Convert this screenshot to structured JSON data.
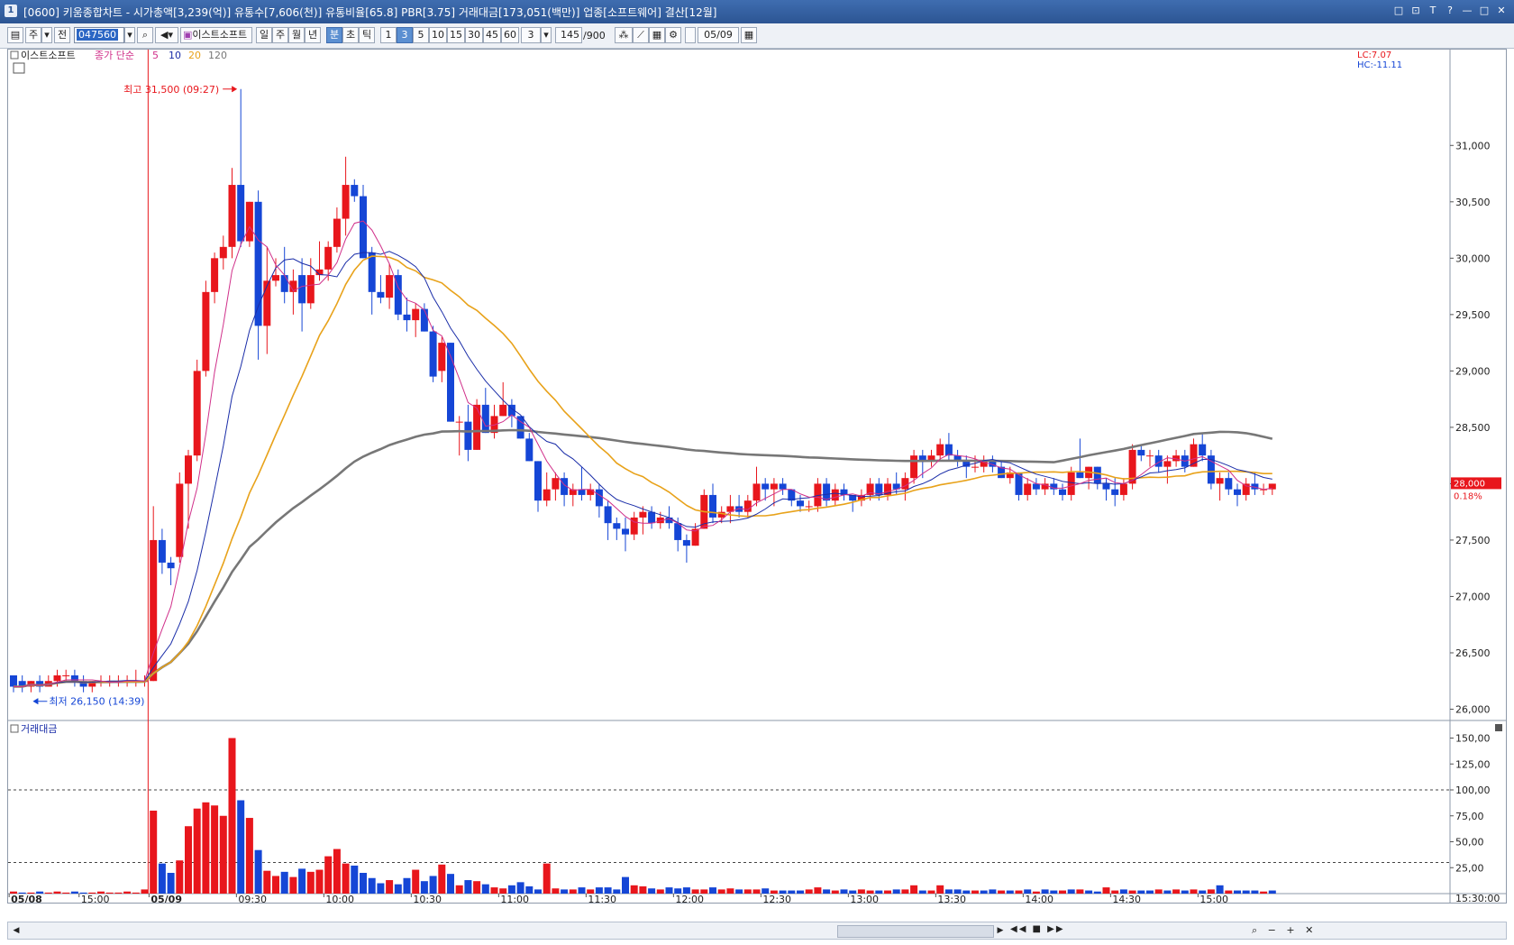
{
  "window": {
    "title": "[0600] 키움종합차트 - 시가총액[3,239(억)] 유통수[7,606(천)] 유통비율[65.8] PBR[3.75] 거래대금[173,051(백만)] 업종[소프트웨어] 결산[12월]",
    "icon_label": "1",
    "controls": [
      "□",
      "⊡",
      "T",
      "?",
      "—",
      "□",
      "✕"
    ]
  },
  "toolbar": {
    "period_label": "주",
    "prev_label": "전",
    "stock_code": "047560",
    "stock_name": "이스트소프트",
    "intervals": [
      "일",
      "주",
      "월",
      "년",
      "분",
      "초",
      "틱"
    ],
    "minute_options": [
      "1",
      "3",
      "5",
      "10",
      "15",
      "30",
      "45",
      "60"
    ],
    "selected_minute": "3",
    "custom_interval": "3",
    "count": "145",
    "count_max": "/900",
    "date": "05/09"
  },
  "chart": {
    "price_title": "이스트소프트",
    "ma_legend_prefix": "종가 단순",
    "ma_periods": [
      "5",
      "10",
      "20",
      "120"
    ],
    "ma_colors": [
      "#d0308a",
      "#1a2da8",
      "#e8a21a",
      "#777777"
    ],
    "high_annotation": "최고 31,500 (09:27)",
    "low_annotation": "최저 26,150 (14:39)",
    "lc_label": "LC:7.07",
    "hc_label": "HC:-11.11",
    "current_price": "28,000",
    "current_change": "0.18%",
    "volume_title": "거래대금",
    "bottom_end_time": "15:30:00"
  },
  "chart_data": [
    {
      "type": "candlestick",
      "title": "이스트소프트",
      "ylim": [
        25900,
        31850
      ],
      "y_ticks": [
        "26,000",
        "26,500",
        "27,000",
        "27,500",
        "28,000",
        "28,500",
        "29,000",
        "29,500",
        "30,000",
        "30,500",
        "31,000"
      ],
      "y_tick_values": [
        26000,
        26500,
        27000,
        27500,
        28000,
        28500,
        29000,
        29500,
        30000,
        30500,
        31000
      ],
      "x_labels": [
        "05/08",
        "15:00",
        "05/09",
        "09:30",
        "10:00",
        "10:30",
        "11:00",
        "11:30",
        "12:00",
        "12:30",
        "13:00",
        "13:30",
        "14:00",
        "14:30",
        "15:00"
      ],
      "x_label_candle_index": [
        0,
        8,
        16,
        26,
        36,
        46,
        56,
        66,
        76,
        86,
        96,
        106,
        116,
        126,
        136
      ],
      "candles": [
        [
          26300,
          26300,
          26150,
          26200
        ],
        [
          26250,
          26300,
          26150,
          26200
        ],
        [
          26200,
          26250,
          26150,
          26250
        ],
        [
          26250,
          26300,
          26150,
          26200
        ],
        [
          26200,
          26300,
          26200,
          26250
        ],
        [
          26250,
          26350,
          26200,
          26300
        ],
        [
          26300,
          26350,
          26250,
          26300
        ],
        [
          26300,
          26350,
          26200,
          26250
        ],
        [
          26250,
          26300,
          26150,
          26200
        ],
        [
          26200,
          26250,
          26150,
          26250
        ],
        [
          26250,
          26300,
          26200,
          26250
        ],
        [
          26250,
          26300,
          26200,
          26250
        ],
        [
          26250,
          26300,
          26200,
          26250
        ],
        [
          26250,
          26300,
          26200,
          26250
        ],
        [
          26250,
          26350,
          26200,
          26250
        ],
        [
          26250,
          26300,
          26200,
          26250
        ],
        [
          26250,
          27800,
          26250,
          27500
        ],
        [
          27500,
          27600,
          27200,
          27300
        ],
        [
          27300,
          27350,
          27100,
          27250
        ],
        [
          27350,
          28100,
          27300,
          28000
        ],
        [
          28000,
          28300,
          27600,
          28250
        ],
        [
          28250,
          29100,
          28200,
          29000
        ],
        [
          29000,
          29800,
          28950,
          29700
        ],
        [
          29700,
          30050,
          29600,
          30000
        ],
        [
          30000,
          30200,
          29900,
          30100
        ],
        [
          30100,
          30800,
          30000,
          30650
        ],
        [
          30650,
          31500,
          30100,
          30150
        ],
        [
          30150,
          30500,
          30100,
          30500
        ],
        [
          30500,
          30600,
          29100,
          29400
        ],
        [
          29400,
          30100,
          29150,
          29800
        ],
        [
          29800,
          30000,
          29750,
          29850
        ],
        [
          29850,
          30100,
          29600,
          29700
        ],
        [
          29700,
          29900,
          29500,
          29800
        ],
        [
          29850,
          30000,
          29350,
          29600
        ],
        [
          29600,
          30000,
          29550,
          29850
        ],
        [
          29850,
          30150,
          29800,
          29900
        ],
        [
          29900,
          30150,
          29800,
          30100
        ],
        [
          30100,
          30450,
          30050,
          30350
        ],
        [
          30350,
          30900,
          30200,
          30650
        ],
        [
          30650,
          30700,
          30500,
          30550
        ],
        [
          30550,
          30650,
          30000,
          30000
        ],
        [
          30050,
          30100,
          29500,
          29700
        ],
        [
          29700,
          29850,
          29600,
          29650
        ],
        [
          29650,
          29950,
          29550,
          29850
        ],
        [
          29850,
          29900,
          29450,
          29500
        ],
        [
          29500,
          29650,
          29350,
          29450
        ],
        [
          29450,
          29600,
          29300,
          29550
        ],
        [
          29550,
          29600,
          29350,
          29350
        ],
        [
          29350,
          29400,
          28900,
          28950
        ],
        [
          29000,
          29300,
          28900,
          29250
        ],
        [
          29250,
          29250,
          28550,
          28550
        ],
        [
          28550,
          28600,
          28250,
          28550
        ],
        [
          28550,
          28700,
          28200,
          28300
        ],
        [
          28300,
          28750,
          28300,
          28700
        ],
        [
          28700,
          28850,
          28450,
          28450
        ],
        [
          28450,
          28700,
          28400,
          28600
        ],
        [
          28600,
          28900,
          28600,
          28700
        ],
        [
          28700,
          28750,
          28500,
          28600
        ],
        [
          28600,
          28600,
          28400,
          28400
        ],
        [
          28400,
          28450,
          28200,
          28200
        ],
        [
          28200,
          28200,
          27750,
          27850
        ],
        [
          27850,
          28100,
          27800,
          27950
        ],
        [
          27950,
          28100,
          27850,
          28050
        ],
        [
          28050,
          28100,
          27800,
          27900
        ],
        [
          27900,
          28000,
          27800,
          27950
        ],
        [
          27950,
          28150,
          27850,
          27900
        ],
        [
          27900,
          28000,
          27850,
          27950
        ],
        [
          27950,
          28000,
          27700,
          27800
        ],
        [
          27800,
          27850,
          27500,
          27650
        ],
        [
          27650,
          27700,
          27500,
          27600
        ],
        [
          27600,
          27700,
          27400,
          27550
        ],
        [
          27550,
          27750,
          27500,
          27700
        ],
        [
          27700,
          27800,
          27550,
          27750
        ],
        [
          27750,
          27800,
          27600,
          27650
        ],
        [
          27650,
          27750,
          27600,
          27700
        ],
        [
          27700,
          27800,
          27600,
          27650
        ],
        [
          27650,
          27700,
          27400,
          27500
        ],
        [
          27500,
          27550,
          27300,
          27450
        ],
        [
          27450,
          27650,
          27450,
          27600
        ],
        [
          27600,
          27950,
          27600,
          27900
        ],
        [
          27900,
          28000,
          27650,
          27700
        ],
        [
          27700,
          27800,
          27650,
          27750
        ],
        [
          27750,
          27900,
          27650,
          27800
        ],
        [
          27800,
          27900,
          27700,
          27750
        ],
        [
          27750,
          27900,
          27700,
          27850
        ],
        [
          27850,
          28150,
          27800,
          28000
        ],
        [
          28000,
          28050,
          27850,
          27950
        ],
        [
          27950,
          28050,
          27800,
          28000
        ],
        [
          28000,
          28050,
          27900,
          27950
        ],
        [
          27950,
          27950,
          27800,
          27850
        ],
        [
          27850,
          27900,
          27750,
          27800
        ],
        [
          27800,
          27850,
          27750,
          27800
        ],
        [
          27800,
          28050,
          27750,
          28000
        ],
        [
          28000,
          28050,
          27800,
          27850
        ],
        [
          27850,
          28000,
          27800,
          27950
        ],
        [
          27950,
          28000,
          27850,
          27900
        ],
        [
          27900,
          27900,
          27750,
          27850
        ],
        [
          27850,
          27950,
          27800,
          27900
        ],
        [
          27900,
          28050,
          27850,
          28000
        ],
        [
          28000,
          28050,
          27850,
          27900
        ],
        [
          27900,
          28050,
          27850,
          28000
        ],
        [
          28000,
          28100,
          27900,
          27950
        ],
        [
          27950,
          28100,
          27850,
          28050
        ],
        [
          28050,
          28300,
          28000,
          28250
        ],
        [
          28250,
          28300,
          28050,
          28200
        ],
        [
          28200,
          28300,
          28150,
          28250
        ],
        [
          28250,
          28400,
          28200,
          28350
        ],
        [
          28350,
          28450,
          28200,
          28250
        ],
        [
          28250,
          28300,
          28150,
          28200
        ],
        [
          28200,
          28250,
          28050,
          28150
        ],
        [
          28150,
          28250,
          28100,
          28150
        ],
        [
          28150,
          28250,
          28100,
          28200
        ],
        [
          28200,
          28250,
          28100,
          28150
        ],
        [
          28150,
          28200,
          28050,
          28050
        ],
        [
          28050,
          28150,
          28000,
          28100
        ],
        [
          28100,
          28100,
          27850,
          27900
        ],
        [
          27900,
          28050,
          27850,
          28000
        ],
        [
          28000,
          28050,
          27900,
          27950
        ],
        [
          27950,
          28050,
          27900,
          28000
        ],
        [
          28000,
          28050,
          27900,
          27950
        ],
        [
          27950,
          28000,
          27850,
          27900
        ],
        [
          27900,
          28150,
          27850,
          28100
        ],
        [
          28100,
          28400,
          28050,
          28050
        ],
        [
          28050,
          28150,
          27950,
          28150
        ],
        [
          28150,
          28150,
          27950,
          28000
        ],
        [
          28000,
          28050,
          27850,
          27950
        ],
        [
          27950,
          28050,
          27800,
          27900
        ],
        [
          27900,
          28050,
          27850,
          28000
        ],
        [
          28000,
          28350,
          27950,
          28300
        ],
        [
          28300,
          28350,
          28200,
          28250
        ],
        [
          28250,
          28300,
          28150,
          28250
        ],
        [
          28250,
          28300,
          28100,
          28150
        ],
        [
          28150,
          28250,
          28000,
          28200
        ],
        [
          28200,
          28300,
          28150,
          28250
        ],
        [
          28250,
          28300,
          28100,
          28150
        ],
        [
          28150,
          28400,
          28150,
          28350
        ],
        [
          28350,
          28450,
          28200,
          28250
        ],
        [
          28250,
          28300,
          27950,
          28000
        ],
        [
          28000,
          28100,
          27850,
          28050
        ],
        [
          28050,
          28100,
          27900,
          27950
        ],
        [
          27950,
          28000,
          27800,
          27900
        ],
        [
          27900,
          28050,
          27850,
          28000
        ],
        [
          28000,
          28100,
          27900,
          27950
        ],
        [
          27950,
          28000,
          27900,
          27950
        ],
        [
          27950,
          28000,
          27900,
          28000
        ]
      ],
      "candle_fields": [
        "open",
        "high",
        "low",
        "close"
      ],
      "up_color": "#e8161c",
      "down_color": "#1546d6"
    },
    {
      "type": "bar",
      "title": "거래대금",
      "ylim": [
        0,
        160
      ],
      "y_ticks": [
        "25,00",
        "50,00",
        "75,00",
        "100,00",
        "125,00",
        "150,00"
      ],
      "y_tick_values": [
        25,
        50,
        75,
        100,
        125,
        150
      ],
      "dashed_levels": [
        30,
        100
      ],
      "values": [
        2,
        1,
        1,
        2,
        1,
        2,
        1,
        2,
        1,
        1,
        2,
        1,
        1,
        2,
        1,
        4,
        80,
        29,
        20,
        32,
        65,
        82,
        88,
        85,
        75,
        150,
        90,
        73,
        42,
        22,
        17,
        21,
        16,
        24,
        21,
        23,
        36,
        43,
        29,
        27,
        20,
        15,
        10,
        13,
        9,
        15,
        23,
        12,
        17,
        28,
        19,
        8,
        13,
        12,
        9,
        6,
        5,
        8,
        11,
        7,
        4,
        29,
        5,
        4,
        4,
        6,
        4,
        6,
        6,
        4,
        16,
        8,
        7,
        5,
        4,
        6,
        5,
        6,
        4,
        4,
        6,
        4,
        5,
        4,
        4,
        4,
        5,
        3,
        3,
        3,
        3,
        4,
        6,
        4,
        3,
        4,
        3,
        4,
        3,
        3,
        3,
        4,
        4,
        8,
        3,
        3,
        8,
        4,
        4,
        3,
        3,
        3,
        4,
        3,
        3,
        3,
        4,
        2,
        4,
        3,
        3,
        4,
        4,
        3,
        2,
        6,
        3,
        4,
        3,
        3,
        3,
        4,
        3,
        4,
        3,
        4,
        3,
        4,
        8,
        3,
        3,
        3,
        3,
        2,
        3
      ],
      "up_flags": [
        1,
        0,
        1,
        0,
        1,
        1,
        1,
        0,
        0,
        1,
        1,
        1,
        1,
        1,
        1,
        1,
        1,
        0,
        0,
        1,
        1,
        1,
        1,
        1,
        1,
        1,
        0,
        1,
        0,
        1,
        1,
        0,
        1,
        0,
        1,
        1,
        1,
        1,
        1,
        0,
        0,
        0,
        0,
        1,
        0,
        0,
        1,
        0,
        0,
        1,
        0,
        1,
        0,
        1,
        0,
        1,
        1,
        0,
        0,
        0,
        0,
        1,
        1,
        0,
        1,
        0,
        1,
        0,
        0,
        0,
        0,
        1,
        1,
        0,
        1,
        0,
        0,
        0,
        1,
        1,
        0,
        1,
        1,
        0,
        1,
        1,
        0,
        1,
        0,
        0,
        0,
        1,
        1,
        0,
        1,
        0,
        0,
        1,
        1,
        0,
        1,
        0,
        1,
        1,
        0,
        1,
        1,
        0,
        0,
        0,
        1,
        0,
        0,
        1,
        0,
        1,
        0,
        1,
        0,
        0,
        1,
        0,
        1,
        0,
        0,
        1,
        1,
        0,
        1,
        0,
        0,
        1,
        0,
        1,
        0,
        1,
        0,
        1,
        0,
        1,
        0,
        0,
        0,
        1,
        0,
        1
      ]
    }
  ]
}
